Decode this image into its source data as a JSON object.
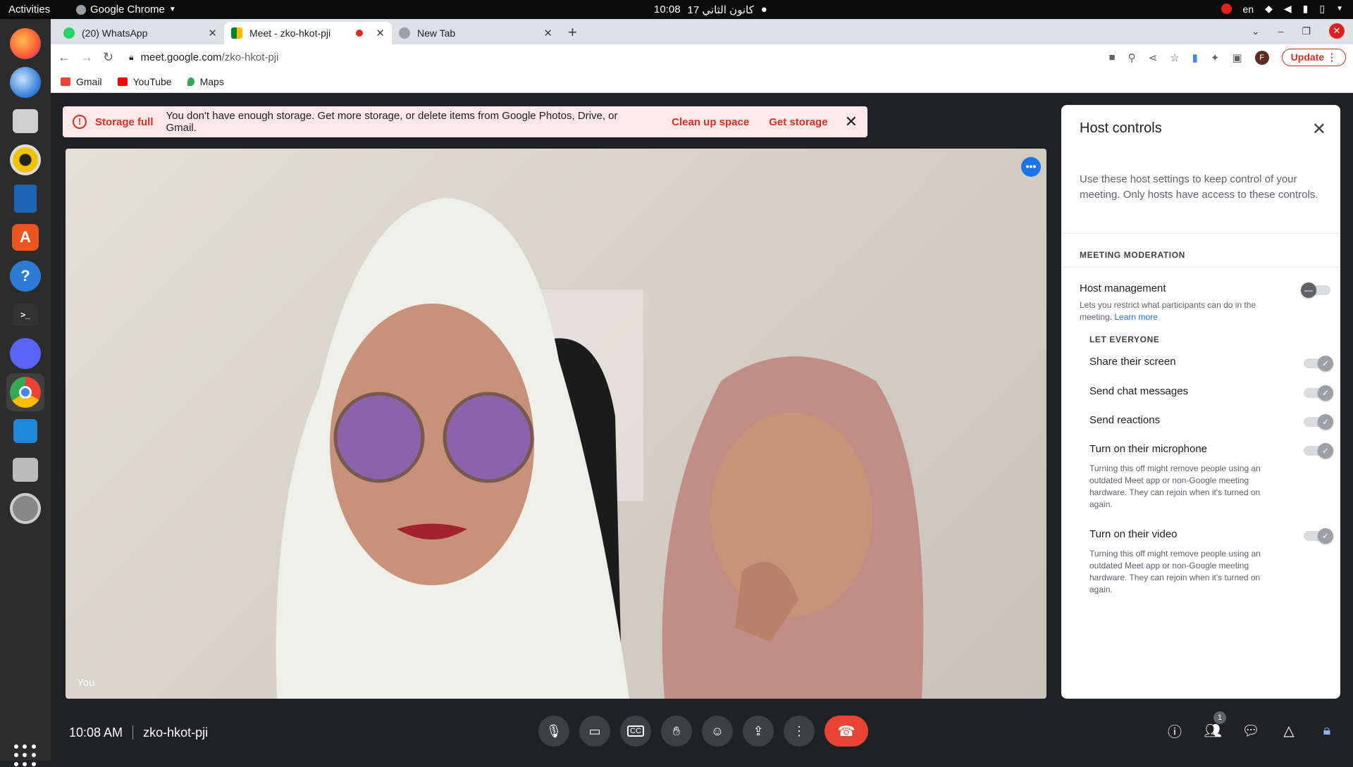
{
  "os": {
    "activities": "Activities",
    "app_name": "Google Chrome",
    "clock_time": "10:08",
    "clock_date": "17 كانون الثاني",
    "lang": "en"
  },
  "tabs": [
    {
      "title": "(20) WhatsApp",
      "active": false
    },
    {
      "title": "Meet - zko-hkot-pji",
      "active": true
    },
    {
      "title": "New Tab",
      "active": false
    }
  ],
  "address": {
    "host": "meet.google.com",
    "path": "/zko-hkot-pji"
  },
  "toolbar": {
    "update_label": "Update",
    "profile_initial": "F"
  },
  "bookmarks": [
    {
      "label": "Gmail",
      "color": "#ea4335"
    },
    {
      "label": "YouTube",
      "color": "#ff0000"
    },
    {
      "label": "Maps",
      "color": "#34a853"
    }
  ],
  "banner": {
    "title": "Storage full",
    "message": "You don't have enough storage. Get more storage, or delete items from Google Photos, Drive, or Gmail.",
    "action1": "Clean up space",
    "action2": "Get storage"
  },
  "video": {
    "self_label": "You"
  },
  "panel": {
    "title": "Host controls",
    "intro": "Use these host settings to keep control of your meeting. Only hosts have access to these controls.",
    "section_moderation": "MEETING MODERATION",
    "host_management": {
      "title": "Host management",
      "desc": "Lets you restrict what participants can do in the meeting.",
      "link": "Learn more",
      "state": "off"
    },
    "section_let_everyone": "LET EVERYONE",
    "items": [
      {
        "title": "Share their screen",
        "state": "on"
      },
      {
        "title": "Send chat messages",
        "state": "on"
      },
      {
        "title": "Send reactions",
        "state": "on"
      },
      {
        "title": "Turn on their microphone",
        "state": "on",
        "desc": "Turning this off might remove people using an outdated Meet app or non-Google meeting hardware. They can rejoin when it's turned on again."
      },
      {
        "title": "Turn on their video",
        "state": "on",
        "desc": "Turning this off might remove people using an outdated Meet app or non-Google meeting hardware. They can rejoin when it's turned on again."
      }
    ]
  },
  "bottom": {
    "time": "10:08 AM",
    "meeting_code": "zko-hkot-pji",
    "participants_count": "1"
  },
  "colors": {
    "accent": "#1a73e8",
    "danger": "#ea4335",
    "meet_bg": "#202124"
  }
}
